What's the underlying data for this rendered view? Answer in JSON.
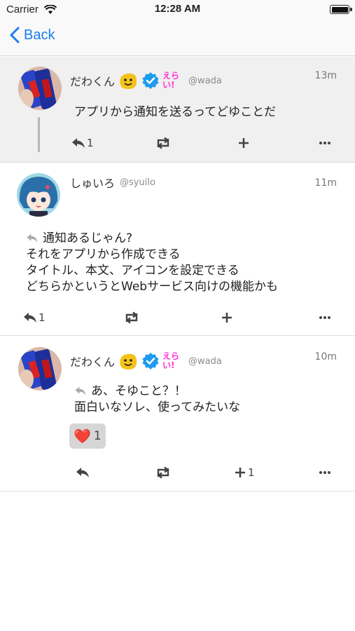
{
  "status_bar": {
    "carrier": "Carrier",
    "time": "12:28 AM"
  },
  "nav": {
    "back_label": "Back"
  },
  "notes": [
    {
      "name": "だわくん",
      "badge_text": "えらい!",
      "handle": "@wada",
      "time": "13m",
      "text": "アプリから通知を送るってどゆことだ",
      "reply_count": "1",
      "renote_count": "",
      "reaction_count": ""
    },
    {
      "name": "しゅいろ",
      "handle": "@syuilo",
      "time": "11m",
      "lines": [
        "通知あるじゃん?",
        "それをアプリから作成できる",
        "タイトル、本文、アイコンを設定できる",
        "どちらかというとWebサービス向けの機能かも"
      ],
      "reply_count": "1",
      "renote_count": "",
      "reaction_count": ""
    },
    {
      "name": "だわくん",
      "badge_text": "えらい!",
      "handle": "@wada",
      "time": "10m",
      "lines": [
        "あ、そゆこと？！",
        "面白いなソレ、使ってみたいな"
      ],
      "reaction": {
        "emoji": "❤️",
        "count": "1"
      },
      "reply_count": "",
      "renote_count": "",
      "reaction_count": "1"
    }
  ],
  "colors": {
    "accent": "#1a7cf0",
    "highlight_bg": "#f0f0f0",
    "verified": "#1d9bf0",
    "badge_pink": "#ff2fd8"
  }
}
